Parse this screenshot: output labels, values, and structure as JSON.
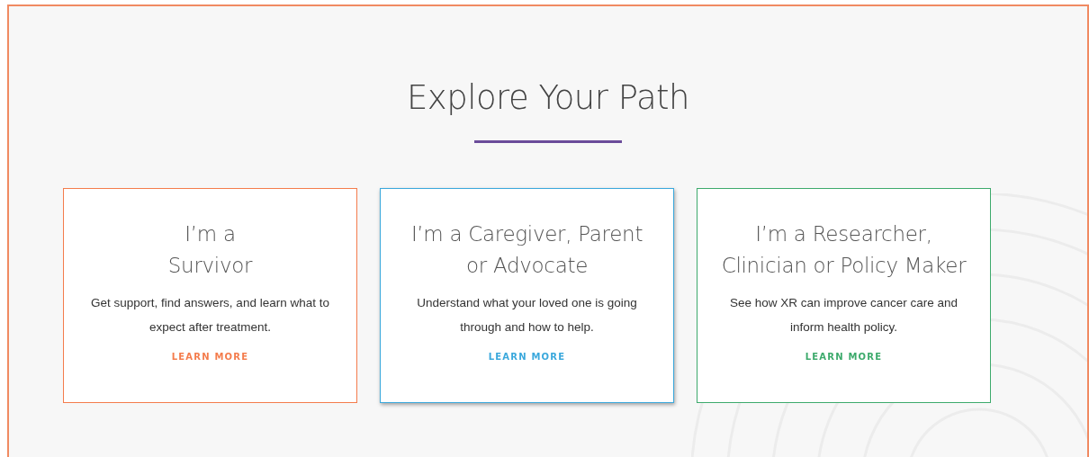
{
  "heading": "Explore Your Path",
  "cards": [
    {
      "title_lines": [
        "I’m a",
        "Survivor"
      ],
      "text": "Get support, find answers, and learn what to expect after treatment.",
      "link": "LEARN MORE",
      "color": "#f47c4c",
      "selected": false
    },
    {
      "title_lines": [
        "I’m a Caregiver, Parent",
        "or Advocate"
      ],
      "text": "Understand what your loved one is going through and how to help.",
      "link": "LEARN MORE",
      "color": "#3aa8dc",
      "selected": true
    },
    {
      "title_lines": [
        "I’m a Researcher,",
        "Clinician or Policy Maker"
      ],
      "text": "See how XR can improve cancer care and inform health policy.",
      "link": "LEARN MORE",
      "color": "#3daa6c",
      "selected": false
    }
  ]
}
